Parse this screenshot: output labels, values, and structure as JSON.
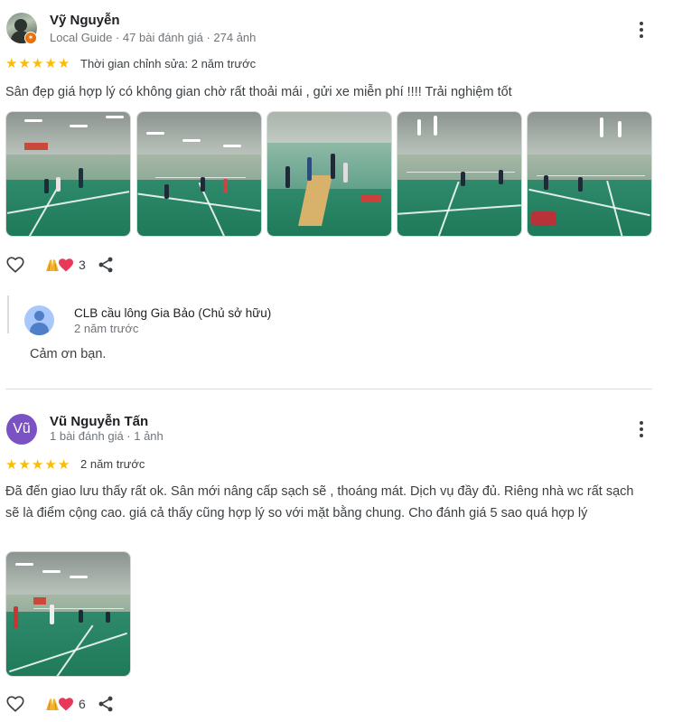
{
  "reviews": [
    {
      "author": "Vỹ Nguyễn",
      "meta": "Local Guide · 47 bài đánh giá · 274 ảnh",
      "avatar_icon": "user-photo-avatar",
      "local_guide_badge": "local-guide-badge-icon",
      "rating": 5,
      "time": "Thời gian chỉnh sửa: 2 năm trước",
      "text": "Sân đẹp giá hợp lý có không gian chờ rất thoải mái , gửi xe miễn phí !!!! Trải nghiệm tốt",
      "photo_count": 5,
      "reaction_count": "3",
      "owner_response": {
        "name": "CLB cầu lông Gia Bảo (Chủ sở hữu)",
        "time": "2 năm trước",
        "text": "Cảm ơn bạn."
      }
    },
    {
      "author": "Vũ Nguyễn Tấn",
      "meta": "1 bài đánh giá · 1 ảnh",
      "avatar_letter": "Vũ",
      "avatar_color": "#7b52c4",
      "rating": 5,
      "time": "2 năm trước",
      "text": "Đã đến giao lưu thấy rất ok. Sân mới nâng cấp sạch sẽ , thoáng mát. Dịch vụ đầy đủ. Riêng nhà wc rất sạch sẽ là điểm cộng cao. giá cả thấy cũng hợp lý so với mặt bằng chung. Cho đánh giá 5 sao quá hợp lý",
      "photo_count": 1,
      "reaction_count": "6"
    }
  ],
  "colors": {
    "star": "#fbbc04",
    "court_green": "#1f7a5a",
    "meta_gray": "#70757a"
  },
  "icons": {
    "like": "heart-outline-icon",
    "reactions": "pray-and-heart-reaction-icons",
    "share": "share-icon",
    "more": "more-vert-icon"
  }
}
